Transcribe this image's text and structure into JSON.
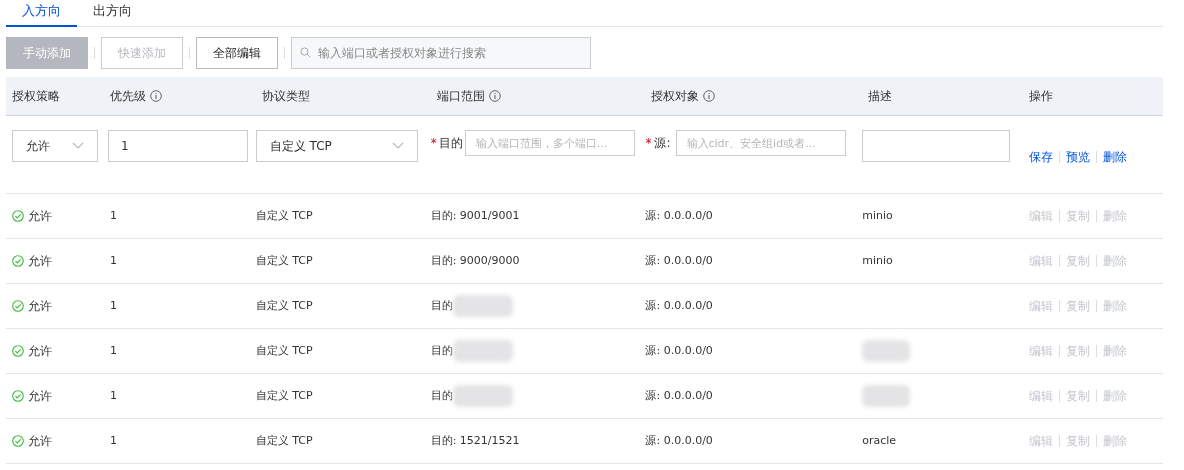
{
  "tabs": [
    {
      "label": "入方向",
      "selected": true
    },
    {
      "label": "出方向",
      "selected": false
    }
  ],
  "toolbar": {
    "buttons": [
      {
        "label": "手动添加",
        "kind": "primary",
        "disabled": true
      },
      {
        "label": "快速添加",
        "kind": "outline",
        "disabled": true
      },
      {
        "label": "全部编辑",
        "kind": "outline",
        "disabled": false
      }
    ],
    "search": {
      "placeholder": "输入端口或者授权对象进行搜索"
    }
  },
  "table": {
    "columns": [
      {
        "label": "授权策略",
        "info": false
      },
      {
        "label": "优先级",
        "info": true
      },
      {
        "label": "协议类型",
        "info": false
      },
      {
        "label": "端口范围",
        "info": true
      },
      {
        "label": "授权对象",
        "info": true
      },
      {
        "label": "描述",
        "info": false
      },
      {
        "label": "操作",
        "info": false
      }
    ],
    "edit_row": {
      "required_mark": "*",
      "policy": "允许",
      "priority": "1",
      "protocol": "自定义 TCP",
      "port_label": "目的",
      "port_placeholder": "输入端口范围，多个端口...",
      "source_label": "源:",
      "source_placeholder": "输入cidr、安全组id或者...",
      "actions": [
        {
          "label": "保存",
          "disabled": false
        },
        {
          "label": "预览",
          "disabled": false
        },
        {
          "label": "删除",
          "disabled": false
        }
      ]
    },
    "rows": [
      {
        "policy": "允许",
        "priority": "1",
        "protocol": "自定义 TCP",
        "port": "目的: 9001/9001",
        "port_blurred": false,
        "source": "源: 0.0.0.0/0",
        "description": "minio",
        "description_blurred": false,
        "actions": [
          {
            "label": "编辑",
            "disabled": true
          },
          {
            "label": "复制",
            "disabled": true
          },
          {
            "label": "删除",
            "disabled": true
          }
        ]
      },
      {
        "policy": "允许",
        "priority": "1",
        "protocol": "自定义 TCP",
        "port": "目的: 9000/9000",
        "port_blurred": false,
        "source": "源: 0.0.0.0/0",
        "description": "minio",
        "description_blurred": false,
        "actions": [
          {
            "label": "编辑",
            "disabled": true
          },
          {
            "label": "复制",
            "disabled": true
          },
          {
            "label": "删除",
            "disabled": true
          }
        ]
      },
      {
        "policy": "允许",
        "priority": "1",
        "protocol": "自定义 TCP",
        "port": "目的",
        "port_blurred": true,
        "source": "源: 0.0.0.0/0",
        "description_blurred": false,
        "actions": [
          {
            "label": "编辑",
            "disabled": true
          },
          {
            "label": "复制",
            "disabled": true
          },
          {
            "label": "删除",
            "disabled": true
          }
        ]
      },
      {
        "policy": "允许",
        "priority": "1",
        "protocol": "自定义 TCP",
        "port": "目的",
        "port_blurred": true,
        "source": "源: 0.0.0.0/0",
        "description_blurred": true,
        "actions": [
          {
            "label": "编辑",
            "disabled": true
          },
          {
            "label": "复制",
            "disabled": true
          },
          {
            "label": "删除",
            "disabled": true
          }
        ]
      },
      {
        "policy": "允许",
        "priority": "1",
        "protocol": "自定义 TCP",
        "port": "目的",
        "port_blurred": true,
        "source": "源: 0.0.0.0/0",
        "description_blurred": true,
        "actions": [
          {
            "label": "编辑",
            "disabled": true
          },
          {
            "label": "复制",
            "disabled": true
          },
          {
            "label": "删除",
            "disabled": true
          }
        ]
      },
      {
        "policy": "允许",
        "priority": "1",
        "protocol": "自定义 TCP",
        "port": "目的: 1521/1521",
        "port_blurred": false,
        "source": "源: 0.0.0.0/0",
        "description": "oracle",
        "description_blurred": false,
        "actions": [
          {
            "label": "编辑",
            "disabled": true
          },
          {
            "label": "复制",
            "disabled": true
          },
          {
            "label": "删除",
            "disabled": true
          }
        ]
      }
    ]
  }
}
